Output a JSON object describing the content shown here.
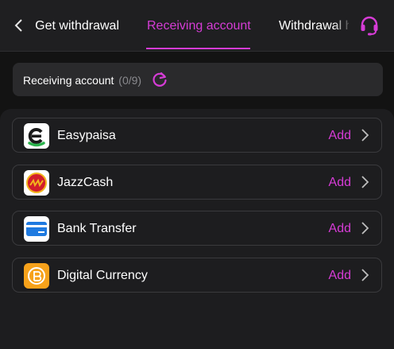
{
  "header": {
    "tabs": [
      {
        "label": "Get withdrawal"
      },
      {
        "label": "Receiving account"
      },
      {
        "label": "Withdrawal history"
      }
    ],
    "accent": "#d63cd6"
  },
  "summary": {
    "label": "Receiving account",
    "count": "(0/9)"
  },
  "accounts": [
    {
      "name": "Easypaisa",
      "action": "Add",
      "icon": "easypaisa-icon"
    },
    {
      "name": "JazzCash",
      "action": "Add",
      "icon": "jazzcash-icon"
    },
    {
      "name": "Bank Transfer",
      "action": "Add",
      "icon": "bank-card-icon"
    },
    {
      "name": "Digital Currency",
      "action": "Add",
      "icon": "crypto-coin-icon"
    }
  ]
}
